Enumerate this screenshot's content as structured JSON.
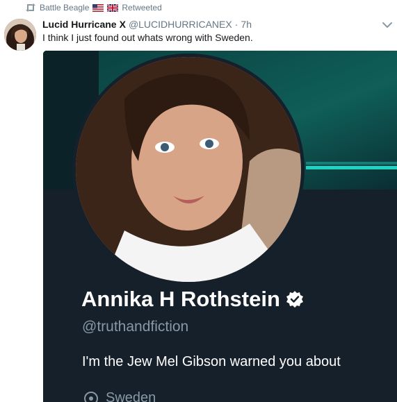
{
  "retweet_bar": {
    "retweeter": "Battle Beagle",
    "action": "Retweeted",
    "flags": [
      "us-flag",
      "uk-flag"
    ]
  },
  "tweet": {
    "author_name": "Lucid Hurricane",
    "author_badge": "X",
    "author_handle": "@LUCIDHURRICANEX",
    "separator": "·",
    "time": "7h",
    "text": "I think I just found out whats wrong with Sweden."
  },
  "embedded_profile": {
    "name": "Annika H Rothstein",
    "handle": "@truthandfiction",
    "bio": "I'm the Jew Mel Gibson warned you about",
    "location": "Sweden"
  },
  "colors": {
    "secondary_text": "#657786",
    "card_background": "#16202b",
    "banner_accent": "#1ed3c3",
    "profile_handle": "#8899a6"
  },
  "icons": [
    "retweet-icon",
    "us-flag-icon",
    "uk-flag-icon",
    "caret-down-icon",
    "verified-badge-icon",
    "location-pin-icon"
  ]
}
